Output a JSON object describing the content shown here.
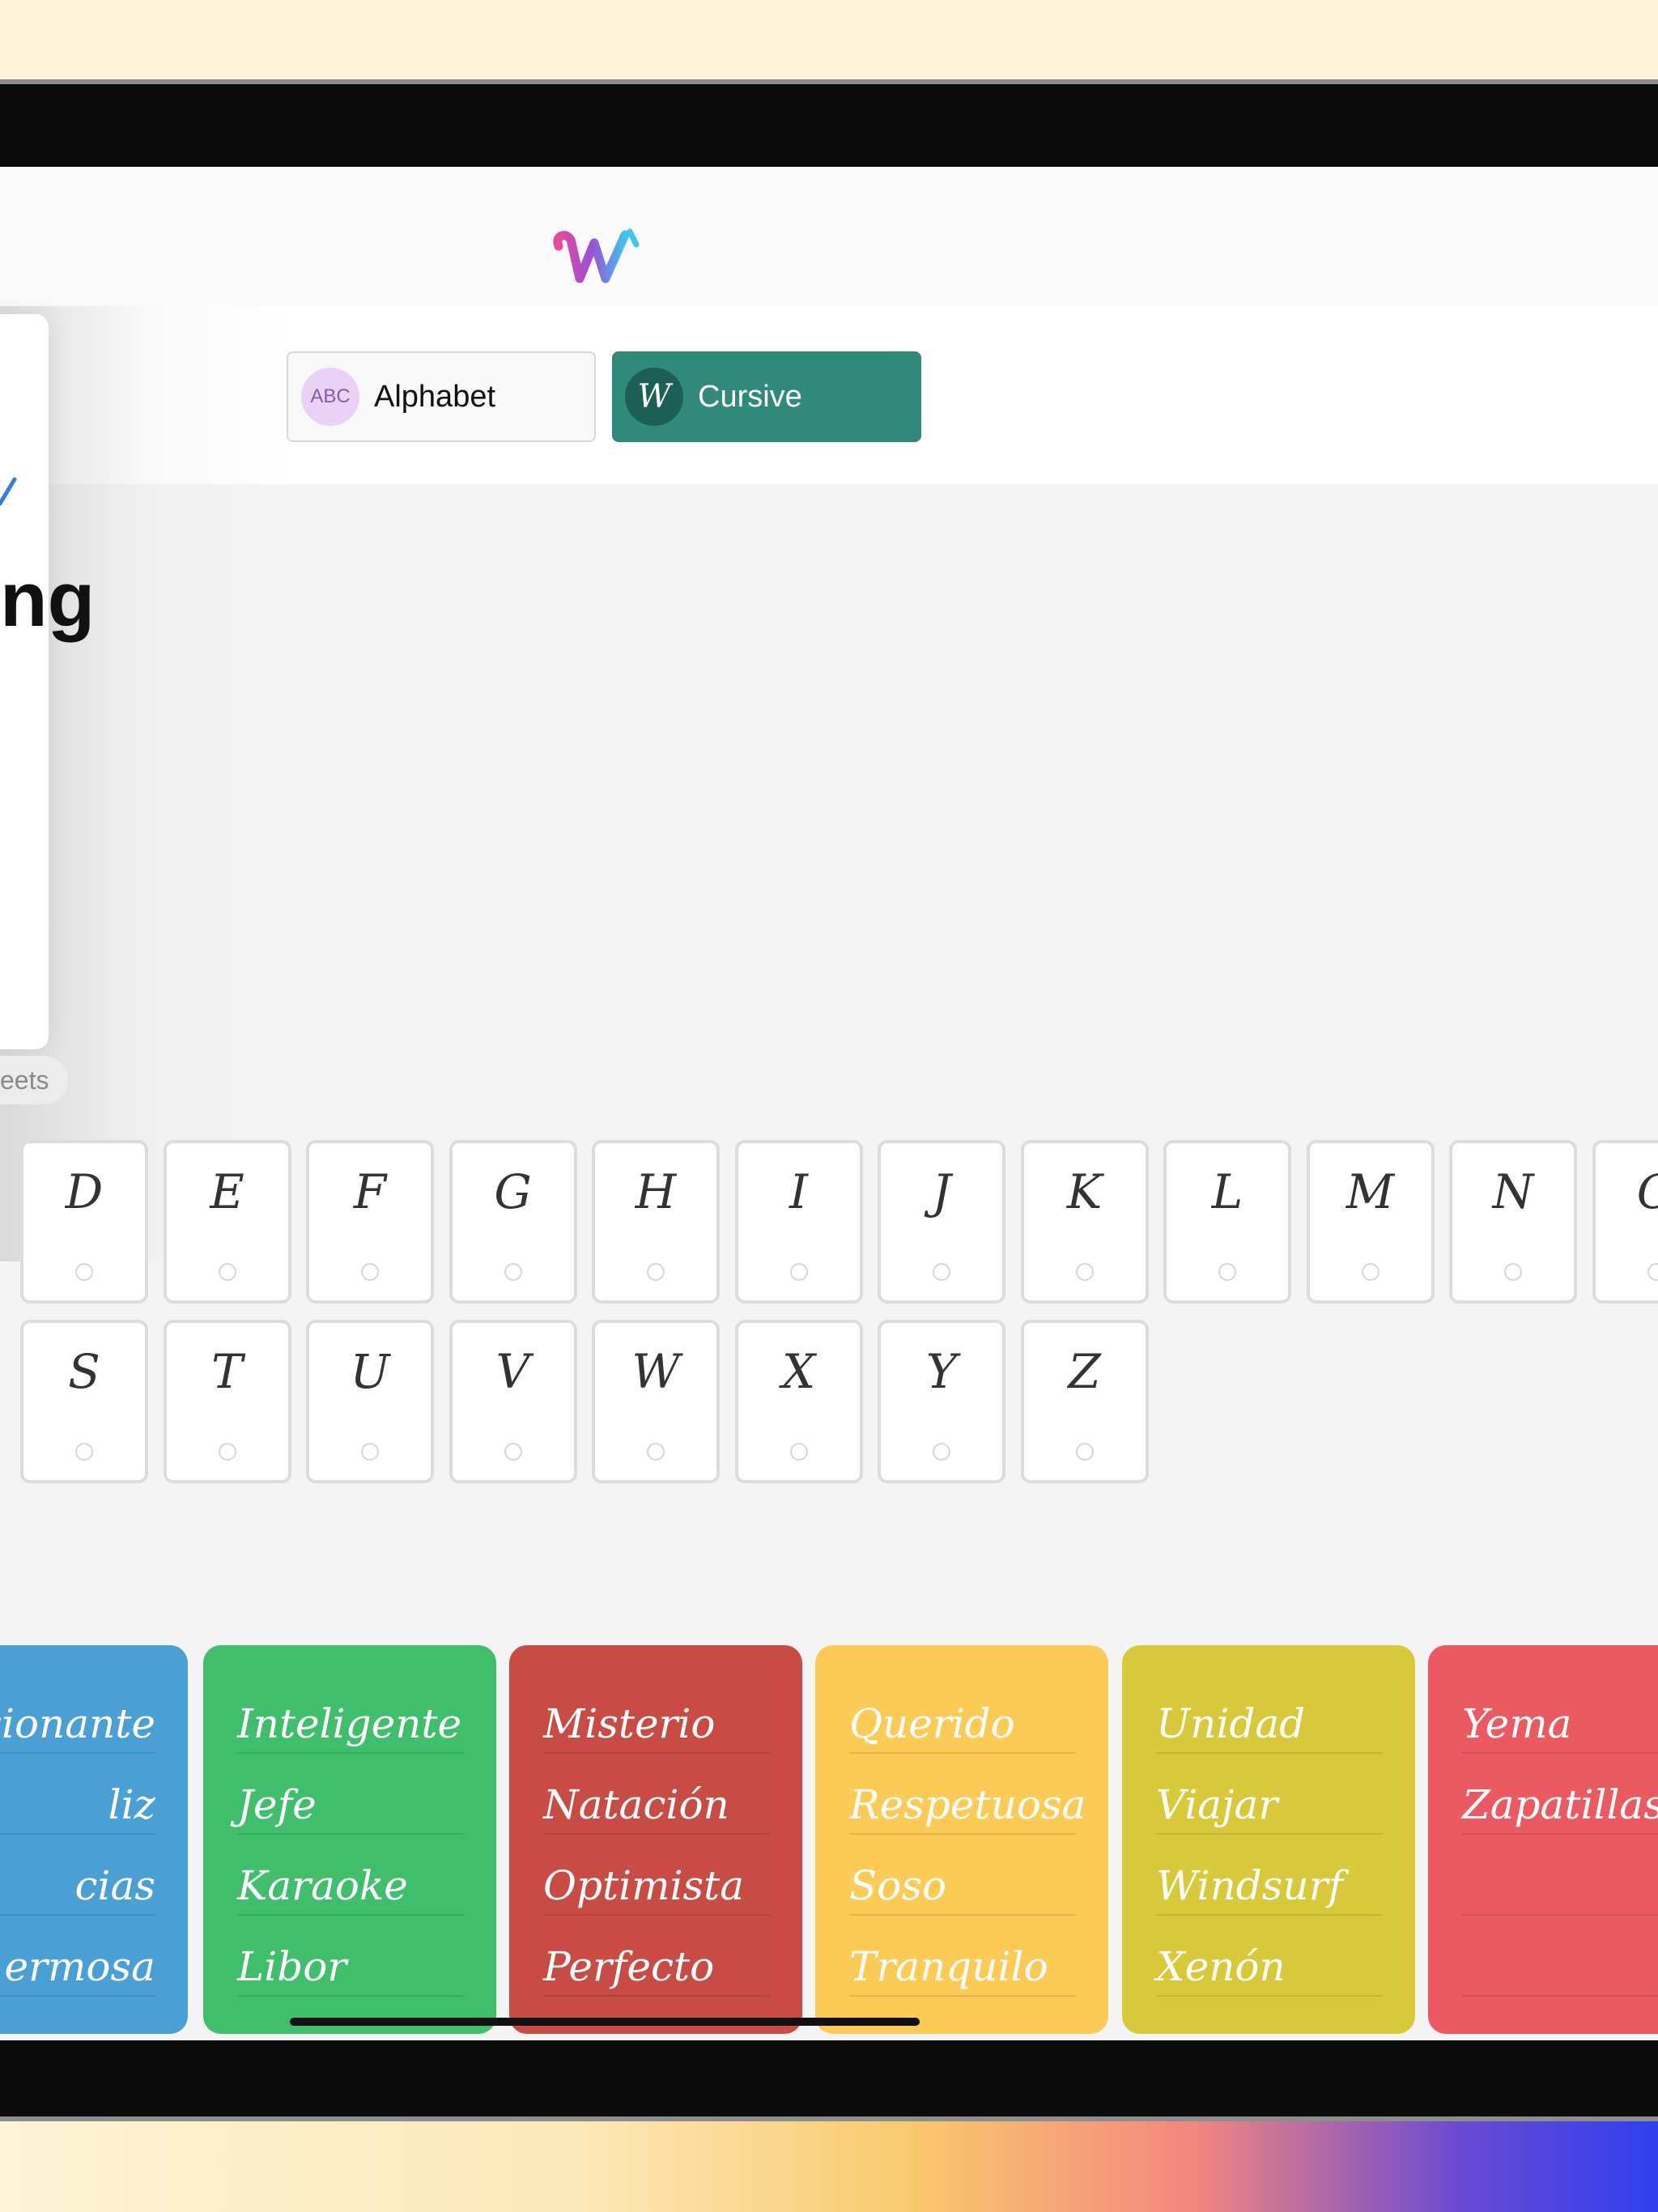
{
  "app": {
    "logo_icon": "w-logo-icon"
  },
  "segments": [
    {
      "label": "Alphabet",
      "badge": "ABC",
      "selected": false
    },
    {
      "label": "Cursive",
      "badge": "W",
      "selected": true
    }
  ],
  "side_panel": {
    "title_fragment": "ng",
    "pill_fragment": "eets",
    "check_icon": "check-icon"
  },
  "letters_row1": [
    "D",
    "E",
    "F",
    "G",
    "H",
    "I",
    "J",
    "K",
    "L",
    "M",
    "N",
    "O"
  ],
  "letters_row2": [
    "S",
    "T",
    "U",
    "V",
    "W",
    "X",
    "Y",
    "Z"
  ],
  "word_cards": [
    {
      "color": "#4aa0d4",
      "words": [
        "mocionante",
        "liz",
        "cias",
        "ermosa"
      ]
    },
    {
      "color": "#3fbf6b",
      "words": [
        "Inteligente",
        "Jefe",
        "Karaoke",
        "Libor"
      ]
    },
    {
      "color": "#c94c44",
      "words": [
        "Misterio",
        "Natación",
        "Optimista",
        "Perfecto"
      ]
    },
    {
      "color": "#fccb55",
      "words": [
        "Querido",
        "Respetuosa",
        "Soso",
        "Tranquilo"
      ]
    },
    {
      "color": "#d8c93a",
      "words": [
        "Unidad",
        "Viajar",
        "Windsurf",
        "Xenón"
      ]
    },
    {
      "color": "#ea5a60",
      "words": [
        "Yema",
        "Zapatillas",
        "",
        ""
      ]
    }
  ],
  "colors": {
    "accent": "#2f8a7a",
    "accent_dark": "#1e5f55"
  }
}
